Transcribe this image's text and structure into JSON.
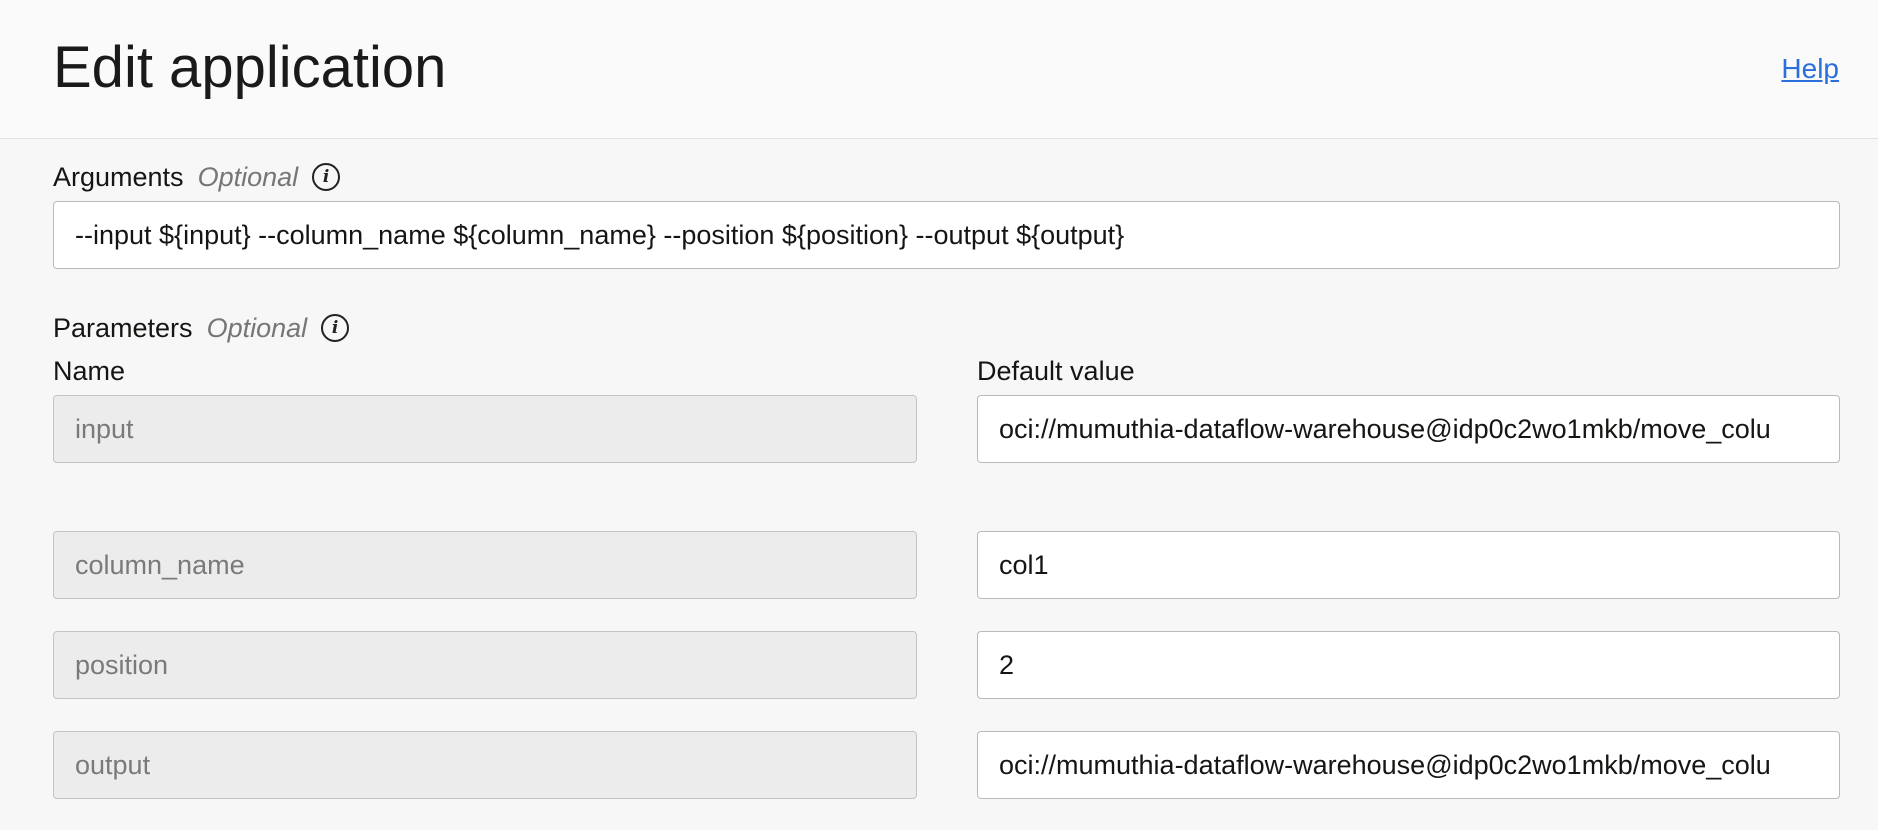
{
  "header": {
    "title": "Edit application",
    "help_label": "Help"
  },
  "arguments": {
    "label": "Arguments",
    "optional": "Optional",
    "value": "--input ${input} --column_name ${column_name} --position ${position} --output ${output}"
  },
  "parameters": {
    "label": "Parameters",
    "optional": "Optional",
    "name_header": "Name",
    "value_header": "Default value",
    "rows": [
      {
        "name": "input",
        "value": "oci://mumuthia-dataflow-warehouse@idp0c2wo1mkb/move_colu"
      },
      {
        "name": "column_name",
        "value": "col1"
      },
      {
        "name": "position",
        "value": "2"
      },
      {
        "name": "output",
        "value": "oci://mumuthia-dataflow-warehouse@idp0c2wo1mkb/move_colu"
      }
    ]
  },
  "icons": {
    "info": "info-icon"
  },
  "colors": {
    "link": "#2a6fdb",
    "readonly_bg": "#ececec",
    "page_bg": "#f7f7f7"
  }
}
